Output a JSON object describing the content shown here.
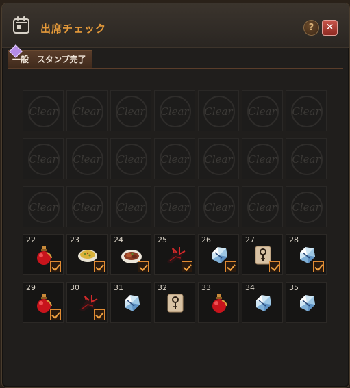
{
  "window": {
    "title": "出席チェック",
    "help_label": "?",
    "close_label": "✕"
  },
  "tabs": [
    "一般",
    "スタンプ完了"
  ],
  "cells": [
    {
      "day": "",
      "state": "cleared",
      "text": "Clear"
    },
    {
      "day": "",
      "state": "cleared",
      "text": "Clear"
    },
    {
      "day": "",
      "state": "cleared",
      "text": "Clear"
    },
    {
      "day": "",
      "state": "cleared",
      "text": "Clear"
    },
    {
      "day": "",
      "state": "cleared",
      "text": "Clear"
    },
    {
      "day": "",
      "state": "cleared",
      "text": "Clear"
    },
    {
      "day": "",
      "state": "cleared",
      "text": "Clear"
    },
    {
      "day": "",
      "state": "cleared",
      "text": "Clear"
    },
    {
      "day": "",
      "state": "cleared",
      "text": "Clear"
    },
    {
      "day": "",
      "state": "cleared",
      "text": "Clear"
    },
    {
      "day": "",
      "state": "cleared",
      "text": "Clear"
    },
    {
      "day": "",
      "state": "cleared",
      "text": "Clear"
    },
    {
      "day": "",
      "state": "cleared",
      "text": "Clear"
    },
    {
      "day": "",
      "state": "cleared",
      "text": "Clear"
    },
    {
      "day": "",
      "state": "cleared",
      "text": "Clear"
    },
    {
      "day": "",
      "state": "cleared",
      "text": "Clear"
    },
    {
      "day": "",
      "state": "cleared",
      "text": "Clear"
    },
    {
      "day": "",
      "state": "cleared",
      "text": "Clear"
    },
    {
      "day": "",
      "state": "cleared",
      "text": "Clear"
    },
    {
      "day": "",
      "state": "cleared",
      "text": "Clear"
    },
    {
      "day": "",
      "state": "cleared",
      "text": "Clear"
    },
    {
      "day": "22",
      "state": "item",
      "item": "red-potion-icon",
      "checked": true
    },
    {
      "day": "23",
      "state": "item",
      "item": "soup-bowl-icon",
      "checked": true
    },
    {
      "day": "24",
      "state": "item",
      "item": "meat-plate-icon",
      "checked": true
    },
    {
      "day": "25",
      "state": "item",
      "item": "dragon-claw-icon",
      "checked": true
    },
    {
      "day": "26",
      "state": "item",
      "item": "crystal-icon",
      "checked": true
    },
    {
      "day": "27",
      "state": "item",
      "item": "scroll-icon",
      "checked": true
    },
    {
      "day": "28",
      "state": "item",
      "item": "crystal-icon",
      "checked": true
    },
    {
      "day": "29",
      "state": "item",
      "item": "red-potion-icon",
      "checked": true
    },
    {
      "day": "30",
      "state": "item",
      "item": "dragon-claw-icon",
      "checked": true
    },
    {
      "day": "31",
      "state": "item",
      "item": "crystal-icon",
      "checked": false
    },
    {
      "day": "32",
      "state": "item",
      "item": "scroll-icon",
      "checked": false
    },
    {
      "day": "33",
      "state": "item",
      "item": "red-potion-icon",
      "checked": false
    },
    {
      "day": "34",
      "state": "item",
      "item": "crystal-icon",
      "checked": false
    },
    {
      "day": "35",
      "state": "item",
      "item": "crystal-icon",
      "checked": false
    }
  ],
  "colors": {
    "title": "#e59a3a",
    "check": "#e08a32"
  }
}
